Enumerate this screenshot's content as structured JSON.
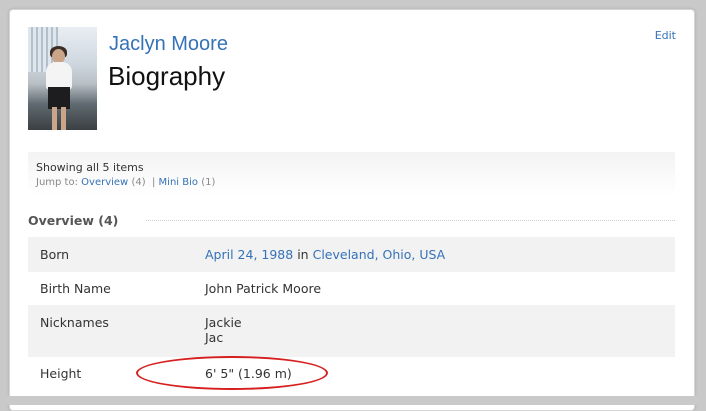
{
  "header": {
    "name": "Jaclyn Moore",
    "title": "Biography",
    "edit": "Edit"
  },
  "summary": {
    "count": "Showing all 5 items",
    "jump_label": "Jump to:",
    "links": [
      {
        "label": "Overview",
        "count": "(4)"
      },
      {
        "label": "Mini Bio",
        "count": "(1)"
      }
    ],
    "separator": "|"
  },
  "overview": {
    "title": "Overview (4)",
    "rows": [
      {
        "label": "Born",
        "date": "April 24, 1988",
        "in": "in",
        "place": "Cleveland, Ohio, USA"
      },
      {
        "label": "Birth Name",
        "value": "John Patrick Moore"
      },
      {
        "label": "Nicknames",
        "values": [
          "Jackie",
          "Jac"
        ]
      },
      {
        "label": "Height",
        "value": "6' 5\" (1.96 m)"
      }
    ]
  },
  "annotation": {
    "color": "#d61f1f"
  }
}
